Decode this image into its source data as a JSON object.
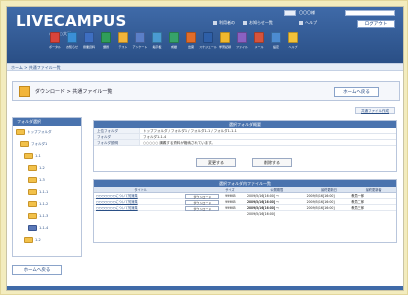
{
  "header": {
    "logo": "LIVECAMPUS",
    "logo_sub": "○○○○大学",
    "user_text": "〇〇〇様",
    "links": [
      "利用者の",
      "お知らせ一覧",
      "ヘルプ"
    ],
    "logout": "ログアウト"
  },
  "nav": [
    {
      "label": "ポータル",
      "color": "#d9443b"
    },
    {
      "label": "お知らせ",
      "color": "#3a8fd6"
    },
    {
      "label": "授業資料",
      "color": "#3e6fc2"
    },
    {
      "label": "課題",
      "color": "#2f9e5a"
    },
    {
      "label": "テスト",
      "color": "#f2b53a"
    },
    {
      "label": "アンケート",
      "color": "#5b7fc8"
    },
    {
      "label": "掲示板",
      "color": "#4a9bd1"
    },
    {
      "label": "成績",
      "color": "#36a36a"
    },
    {
      "label": "出席",
      "color": "#e06c2a"
    },
    {
      "label": "スケジュール",
      "color": "#2e5fa8"
    },
    {
      "label": "学習記録",
      "color": "#f0b82e"
    },
    {
      "label": "ファイル",
      "color": "#8a61c2"
    },
    {
      "label": "メール",
      "color": "#d6533c"
    },
    {
      "label": "設定",
      "color": "#4c8bd1"
    },
    {
      "label": "ヘルプ",
      "color": "#f2c23a"
    }
  ],
  "breadcrumb": "ホーム > 共通ファイル一覧",
  "page": {
    "title": "ダウンロード > 共通ファイル一覧",
    "home_button": "ホームへ戻る",
    "folder_create": "共通ファイル作成"
  },
  "sidebar": {
    "title": "フォルダ選択",
    "tree": [
      {
        "label": "トップフォルダ",
        "level": 0,
        "color": "yellow"
      },
      {
        "label": "フォルダ1",
        "level": 1,
        "color": "yellow"
      },
      {
        "label": "1-1",
        "level": 2,
        "color": "yellow"
      },
      {
        "label": "1-2",
        "level": 3,
        "color": "yellow"
      },
      {
        "label": "1-3",
        "level": 3,
        "color": "yellow"
      },
      {
        "label": "1-1-1",
        "level": 3,
        "color": "yellow"
      },
      {
        "label": "1-1-2",
        "level": 3,
        "color": "yellow"
      },
      {
        "label": "1-1-3",
        "level": 3,
        "color": "yellow"
      },
      {
        "label": "1-1-4",
        "level": 3,
        "color": "blue"
      },
      {
        "label": "1-2",
        "level": 2,
        "color": "yellow"
      }
    ],
    "home_button": "ホームへ戻る"
  },
  "info": {
    "title": "選択フォルダ概要",
    "rows": [
      {
        "key": "上位フォルダ",
        "value": "トップフォルダ / フォルダ1 / フォルダ1-1 / フォルダ1-1-1"
      },
      {
        "key": "フォルダ",
        "value": "フォルダ1-1-4"
      },
      {
        "key": "フォルダ説明",
        "value": "○○○○○ 講義する資料が格納されています。"
      }
    ],
    "edit_button": "変更する",
    "delete_button": "削除する"
  },
  "files": {
    "title": "選択フォルダ内ファイル一覧",
    "columns": [
      "タイトル",
      "",
      "サイズ",
      "公開期間",
      "最終更新日",
      "最終更新者"
    ],
    "rows": [
      {
        "title": "○○○○○○○について知識集",
        "action": "ダウンロード",
        "size": "999KB",
        "period": "2009/5/16[16:00] ～ 2009/5/16[16:00]",
        "updated": "2009/5/16[16:00]",
        "updater": "教員一郎"
      },
      {
        "title": "○○○○○○○について知識集",
        "action": "ダウンロード",
        "size": "999KB",
        "period": "2009/5/16[16:00] ～ 2009/5/16[16:00]",
        "updated": "2009/5/16[16:00]",
        "updater": "教員二郎"
      },
      {
        "title": "○○○○○○○について知識集",
        "action": "ダウンロード",
        "size": "999KB",
        "period": "2009/5/16[16:00] ～ 2009/5/16[16:00]",
        "updated": "2009/5/16[16:00]",
        "updater": "教員三郎"
      }
    ]
  }
}
